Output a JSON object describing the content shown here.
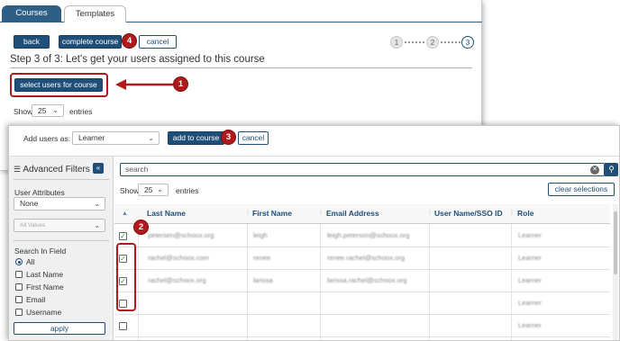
{
  "tabs": [
    {
      "label": "Courses",
      "active": true
    },
    {
      "label": "Templates",
      "active": false
    }
  ],
  "wizard": {
    "back_label": "back",
    "complete_label": "complete course",
    "cancel_label": "cancel",
    "steps": [
      "1",
      "2",
      "3"
    ],
    "current_step": 3,
    "title": "Step 3 of 3: Let's get your users assigned to this course",
    "select_users_label": "select users for course",
    "show_label": "Show",
    "page_size": "25",
    "entries_label": "entries"
  },
  "callouts": [
    "1",
    "2",
    "3",
    "4"
  ],
  "add_bar": {
    "add_as_label": "Add users as:",
    "role_value": "Learner",
    "add_label": "add to course",
    "cancel_label": "cancel"
  },
  "filters": {
    "heading": "Advanced Filters",
    "collapse_glyph": "«",
    "user_attributes_label": "User Attributes",
    "attribute_value": "None",
    "values_placeholder": "All Values",
    "search_in_label": "Search In Field",
    "fields": [
      {
        "label": "All",
        "type": "radio",
        "checked": true
      },
      {
        "label": "Last Name",
        "type": "checkbox",
        "checked": false
      },
      {
        "label": "First Name",
        "type": "checkbox",
        "checked": false
      },
      {
        "label": "Email",
        "type": "checkbox",
        "checked": false
      },
      {
        "label": "Username",
        "type": "checkbox",
        "checked": false
      }
    ],
    "apply_label": "apply"
  },
  "table": {
    "search_value": "search",
    "show_label": "Show",
    "page_size": "25",
    "entries_label": "entries",
    "clear_label": "clear selections",
    "columns": [
      "Last Name",
      "First Name",
      "Email Address",
      "User Name/SSO ID",
      "Role"
    ],
    "rows": [
      {
        "checked": true,
        "last": "petersen@schoox.org",
        "first": "leigh",
        "email": "leigh.peterson@schoox.org",
        "user": "",
        "role": "Learner"
      },
      {
        "checked": true,
        "last": "rachel@schoox.com",
        "first": "renee",
        "email": "renee.rachel@schoox.org",
        "user": "",
        "role": "Learner"
      },
      {
        "checked": true,
        "last": "rachel@schoox.org",
        "first": "larissa",
        "email": "larissa.rachel@schoox.org",
        "user": "",
        "role": "Learner"
      },
      {
        "checked": false,
        "last": "",
        "first": "",
        "email": "",
        "user": "",
        "role": "Learner"
      },
      {
        "checked": false,
        "last": "",
        "first": "",
        "email": "",
        "user": "",
        "role": "Learner"
      }
    ]
  },
  "colors": {
    "primary": "#1f4e79",
    "callout": "#b01a1a"
  }
}
